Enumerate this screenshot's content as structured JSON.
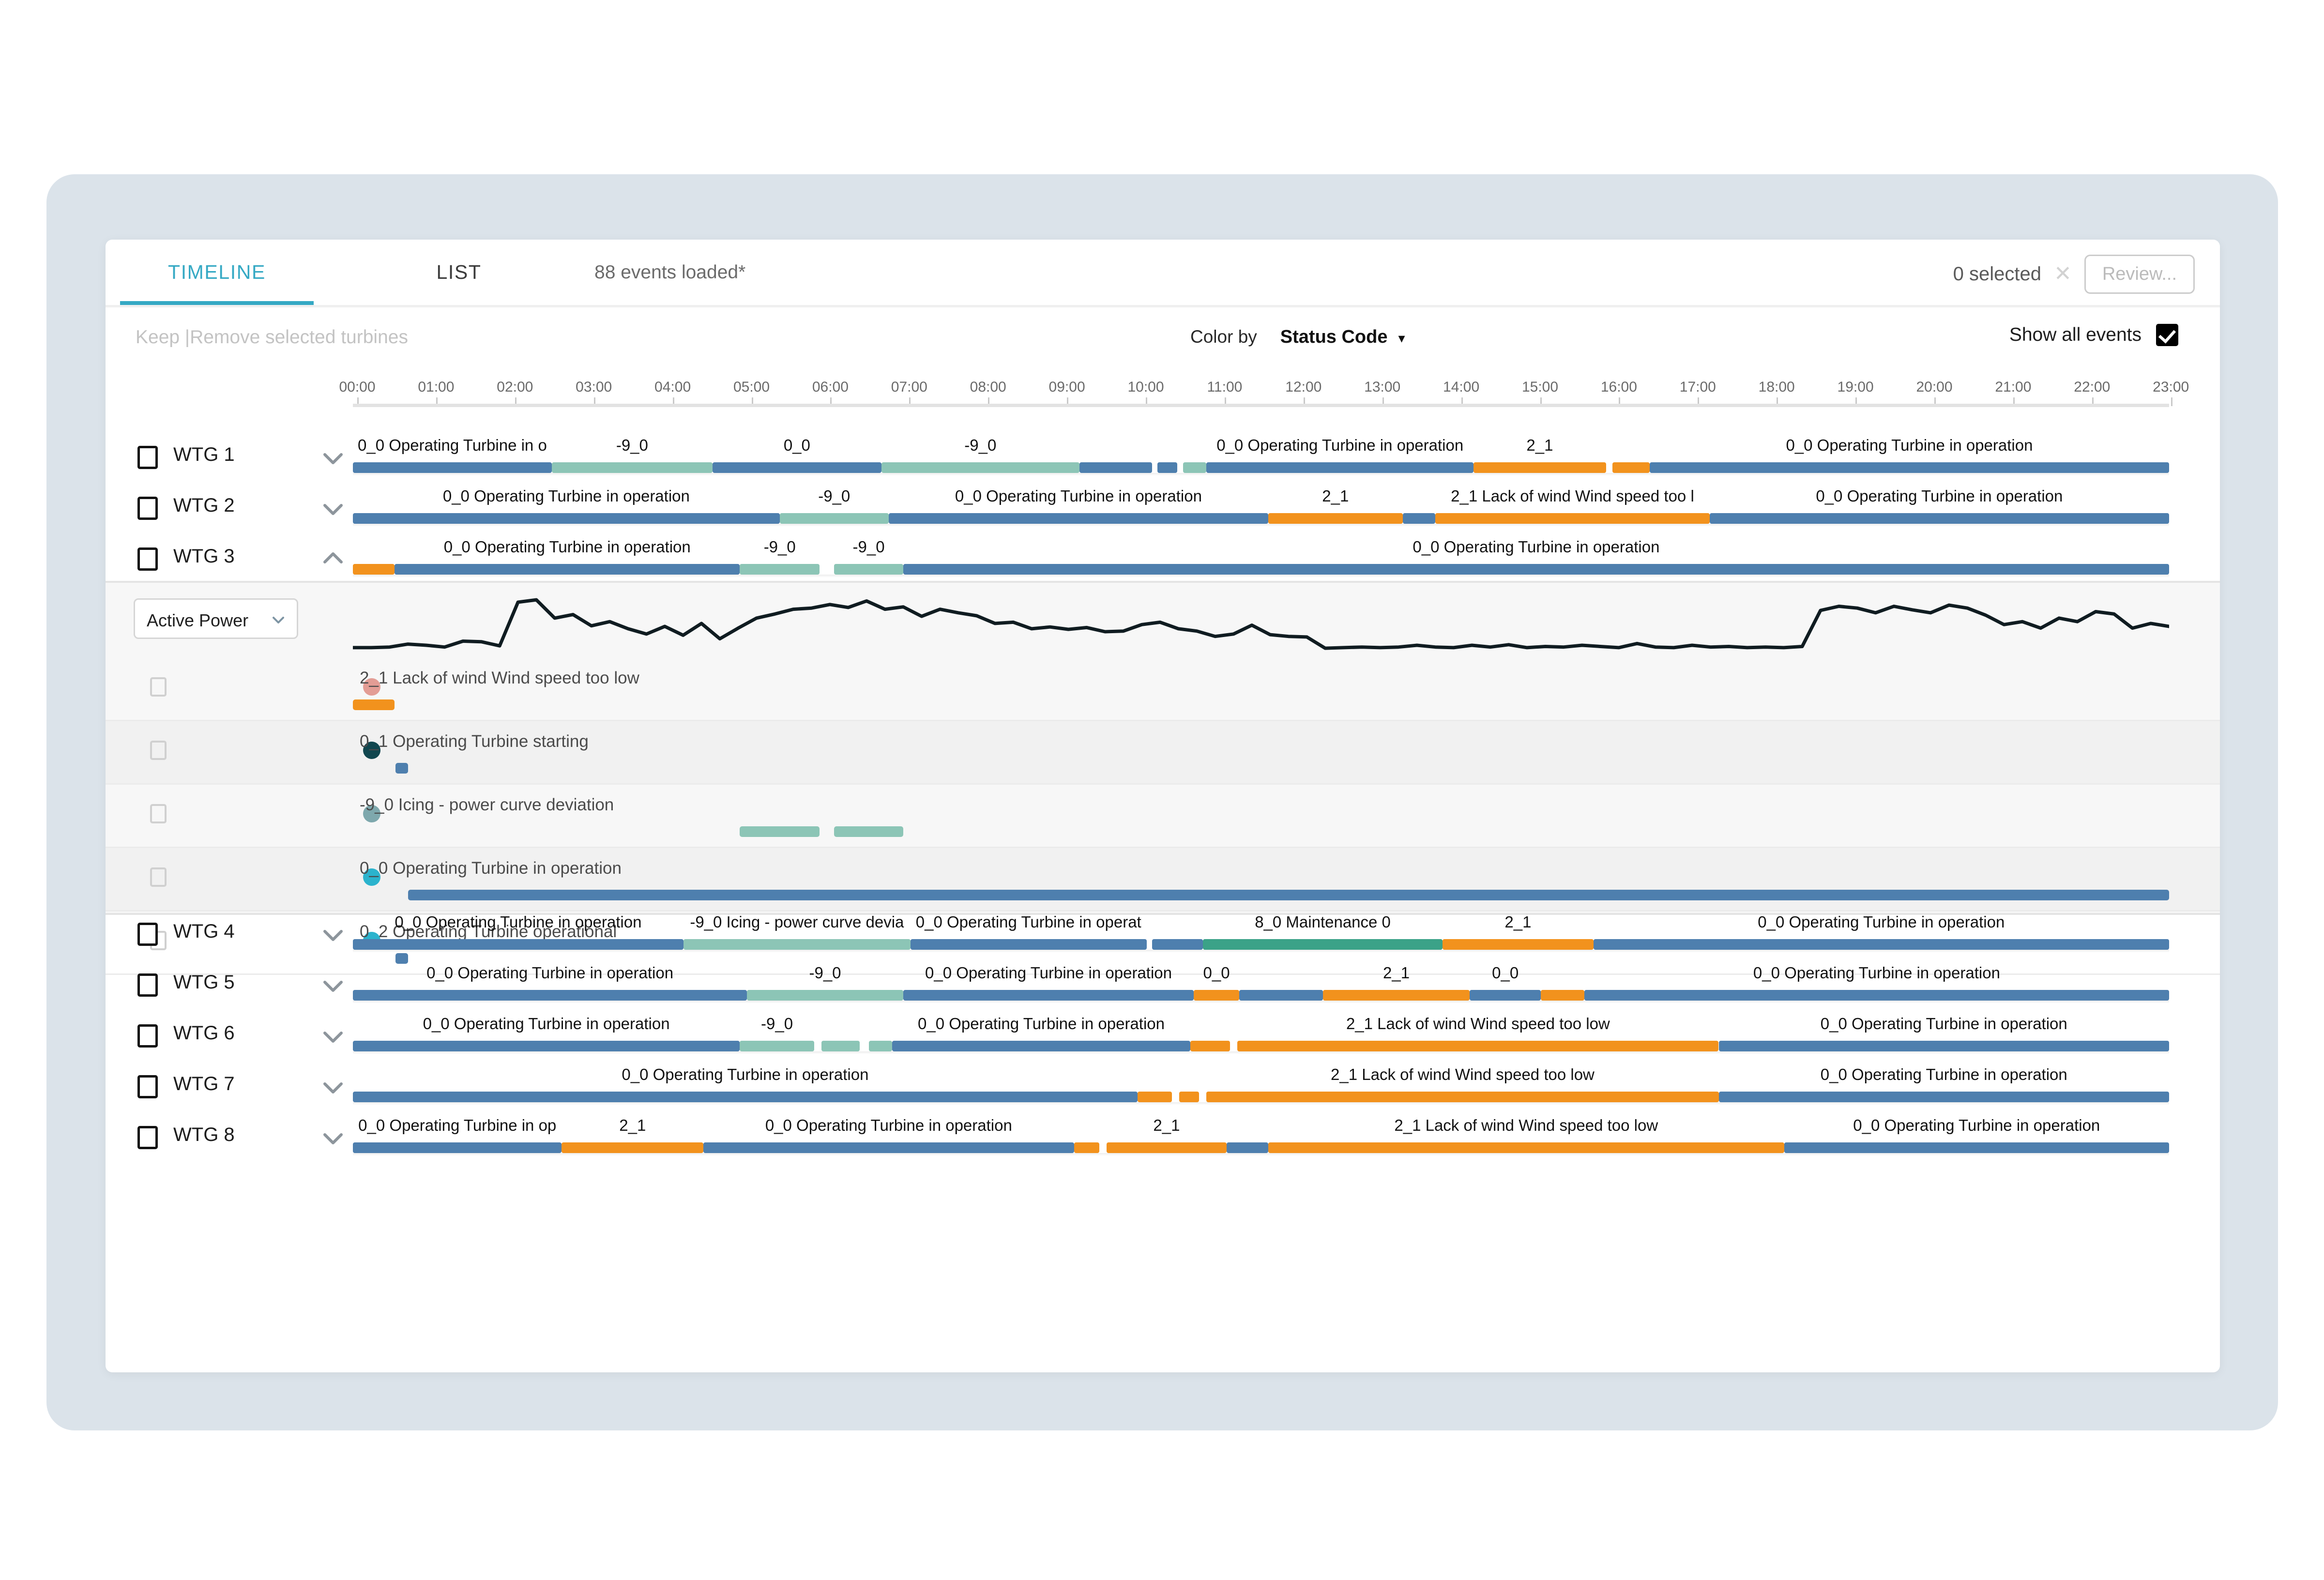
{
  "header": {
    "tabs": [
      {
        "id": "timeline",
        "label": "TIMELINE",
        "active": true
      },
      {
        "id": "list",
        "label": "LIST",
        "active": false
      }
    ],
    "events_loaded": "88 events loaded*",
    "selected_count": "0 selected",
    "clear_selection_icon": "close-icon",
    "review_button": "Review..."
  },
  "toolbar": {
    "keep_label": "Keep",
    "separator": " |",
    "remove_label": "Remove selected turbines",
    "colorby_label": "Color by",
    "colorby_value": "Status Code",
    "colorby_caret": "caret-down-icon",
    "show_all_events_label": "Show all events",
    "show_all_events_checked": true
  },
  "axis": {
    "ticks": [
      "00:00",
      "01:00",
      "02:00",
      "03:00",
      "04:00",
      "05:00",
      "06:00",
      "07:00",
      "08:00",
      "09:00",
      "10:00",
      "11:00",
      "12:00",
      "13:00",
      "14:00",
      "15:00",
      "16:00",
      "17:00",
      "18:00",
      "19:00",
      "20:00",
      "21:00",
      "22:00",
      "23:00"
    ]
  },
  "colors": {
    "accent": "#35a9c4",
    "operating_blue": "#4e7fae",
    "lack_of_wind_orange": "#f2921d",
    "icing_green": "#8cc5b6",
    "maintenance_teal": "#3ba288",
    "dot_salmon": "#e39d95",
    "dot_dark_teal": "#11474f",
    "dot_grey_teal": "#7ea8ad",
    "dot_cyan": "#2bb3cd"
  },
  "turbines": [
    {
      "name": "WTG 1",
      "expanded": false,
      "chevron": "chevron-down-icon",
      "checked": false,
      "segments": [
        {
          "label": "0_0 Operating Turbine in o",
          "start": 0.0,
          "end": 0.1095,
          "color": "operating_blue"
        },
        {
          "label": "-9_0",
          "start": 0.1095,
          "end": 0.198,
          "color": "icing_green"
        },
        {
          "label": "0_0",
          "start": 0.198,
          "end": 0.291,
          "color": "operating_blue"
        },
        {
          "label": "-9_0",
          "start": 0.291,
          "end": 0.4,
          "color": "icing_green"
        },
        {
          "label": "",
          "start": 0.4,
          "end": 0.44,
          "color": "operating_blue"
        },
        {
          "label": "",
          "start": 0.443,
          "end": 0.454,
          "color": "operating_blue"
        },
        {
          "label": "",
          "start": 0.457,
          "end": 0.47,
          "color": "icing_green"
        },
        {
          "label": "0_0 Operating Turbine in operation",
          "start": 0.47,
          "end": 0.617,
          "color": "operating_blue"
        },
        {
          "label": "2_1",
          "start": 0.617,
          "end": 0.69,
          "color": "lack_of_wind_orange"
        },
        {
          "label": "",
          "start": 0.6935,
          "end": 0.714,
          "color": "lack_of_wind_orange"
        },
        {
          "label": "0_0 Operating Turbine in operation",
          "start": 0.714,
          "end": 1.0,
          "color": "operating_blue"
        }
      ]
    },
    {
      "name": "WTG 2",
      "expanded": false,
      "chevron": "chevron-down-icon",
      "checked": false,
      "segments": [
        {
          "label": "0_0 Operating Turbine in operation",
          "start": 0.0,
          "end": 0.235,
          "color": "operating_blue"
        },
        {
          "label": "-9_0",
          "start": 0.235,
          "end": 0.295,
          "color": "icing_green"
        },
        {
          "label": "0_0 Operating Turbine in operation",
          "start": 0.295,
          "end": 0.504,
          "color": "operating_blue"
        },
        {
          "label": "2_1",
          "start": 0.504,
          "end": 0.578,
          "color": "lack_of_wind_orange"
        },
        {
          "label": "",
          "start": 0.578,
          "end": 0.596,
          "color": "operating_blue"
        },
        {
          "label": "2_1 Lack of wind Wind speed too l",
          "start": 0.596,
          "end": 0.747,
          "color": "lack_of_wind_orange"
        },
        {
          "label": "0_0 Operating Turbine in operation",
          "start": 0.747,
          "end": 1.0,
          "color": "operating_blue"
        }
      ]
    },
    {
      "name": "WTG 3",
      "expanded": true,
      "chevron": "chevron-up-icon",
      "checked": false,
      "segments": [
        {
          "label": "",
          "start": 0.0,
          "end": 0.023,
          "color": "lack_of_wind_orange"
        },
        {
          "label": "0_0 Operating Turbine in operation",
          "start": 0.023,
          "end": 0.213,
          "color": "operating_blue"
        },
        {
          "label": "-9_0",
          "start": 0.213,
          "end": 0.257,
          "color": "icing_green"
        },
        {
          "label": "-9_0",
          "start": 0.265,
          "end": 0.303,
          "color": "icing_green"
        },
        {
          "label": "0_0 Operating Turbine in operation",
          "start": 0.303,
          "end": 1.0,
          "color": "operating_blue"
        }
      ]
    }
  ],
  "detail": {
    "metric_select_value": "Active Power",
    "metric_select_caret": "chevron-down-icon",
    "chart_data": {
      "type": "line",
      "title": "Active Power",
      "xlabel": "",
      "ylabel": "Active Power",
      "grid": false,
      "legend": "none",
      "x": [
        0,
        1,
        2,
        3,
        4,
        5,
        6,
        7,
        8,
        9,
        10,
        11,
        12,
        13,
        14,
        15,
        16,
        17,
        18,
        19,
        20,
        21,
        22,
        23,
        24,
        25,
        26,
        27,
        28,
        29,
        30,
        31,
        32,
        33,
        34,
        35,
        36,
        37,
        38,
        39,
        40,
        41,
        42,
        43,
        44,
        45,
        46,
        47,
        48,
        49,
        50,
        51,
        52,
        53,
        54,
        55,
        56,
        57,
        58,
        59,
        60,
        61,
        62,
        63,
        64,
        65,
        66,
        67,
        68,
        69,
        70,
        71,
        72,
        73,
        74,
        75,
        76,
        77,
        78,
        79,
        80,
        81,
        82,
        83,
        84,
        85,
        86,
        87,
        88,
        89,
        90,
        91,
        92,
        93,
        94,
        95,
        96,
        97,
        98,
        99
      ],
      "values": [
        5,
        5,
        6,
        11,
        9,
        6,
        16,
        15,
        8,
        82,
        86,
        55,
        61,
        42,
        49,
        37,
        28,
        41,
        26,
        46,
        20,
        38,
        55,
        62,
        70,
        72,
        78,
        73,
        84,
        70,
        74,
        58,
        70,
        64,
        59,
        46,
        48,
        37,
        40,
        36,
        39,
        32,
        33,
        44,
        48,
        37,
        33,
        24,
        28,
        43,
        27,
        24,
        23,
        4,
        5,
        6,
        5,
        6,
        9,
        6,
        5,
        9,
        6,
        10,
        5,
        7,
        6,
        9,
        7,
        5,
        12,
        6,
        5,
        9,
        6,
        7,
        5,
        6,
        5,
        7,
        68,
        75,
        72,
        64,
        75,
        69,
        64,
        77,
        72,
        60,
        44,
        49,
        38,
        55,
        49,
        66,
        62,
        38,
        46,
        41
      ],
      "ylim": [
        0,
        100
      ]
    },
    "events": [
      {
        "label": "2_1 Lack of wind Wind speed too low",
        "dot": "dot_salmon",
        "checked": false,
        "bars": [
          {
            "start": 0.0,
            "end": 0.023,
            "color": "lack_of_wind_orange"
          }
        ]
      },
      {
        "label": "0_1 Operating Turbine starting",
        "dot": "dot_dark_teal",
        "checked": false,
        "bars": [
          {
            "start": 0.0235,
            "end": 0.0305,
            "color": "operating_blue"
          }
        ]
      },
      {
        "label": "-9_0 Icing - power curve deviation",
        "dot": "dot_grey_teal",
        "checked": false,
        "bars": [
          {
            "start": 0.213,
            "end": 0.257,
            "color": "icing_green"
          },
          {
            "start": 0.265,
            "end": 0.303,
            "color": "icing_green"
          }
        ]
      },
      {
        "label": "0_0 Operating Turbine in operation",
        "dot": "dot_cyan",
        "checked": false,
        "bars": [
          {
            "start": 0.0305,
            "end": 1.0,
            "color": "operating_blue"
          }
        ]
      },
      {
        "label": "0_2 Operating Turbine operational",
        "dot": "dot_cyan",
        "checked": false,
        "bars": [
          {
            "start": 0.0235,
            "end": 0.0305,
            "color": "operating_blue"
          }
        ]
      }
    ]
  },
  "turbines_lower": [
    {
      "name": "WTG 4",
      "expanded": false,
      "chevron": "chevron-down-icon",
      "checked": false,
      "segments": [
        {
          "label": "0_0 Operating Turbine in operation",
          "start": 0.0,
          "end": 0.182,
          "color": "operating_blue"
        },
        {
          "label": "-9_0 Icing - power curve devia",
          "start": 0.182,
          "end": 0.307,
          "color": "icing_green"
        },
        {
          "label": "0_0 Operating Turbine in operat",
          "start": 0.307,
          "end": 0.437,
          "color": "operating_blue"
        },
        {
          "label": "",
          "start": 0.44,
          "end": 0.468,
          "color": "operating_blue"
        },
        {
          "label": "8_0 Maintenance 0",
          "start": 0.468,
          "end": 0.6,
          "color": "maintenance_teal"
        },
        {
          "label": "2_1",
          "start": 0.6,
          "end": 0.683,
          "color": "lack_of_wind_orange"
        },
        {
          "label": "0_0 Operating Turbine in operation",
          "start": 0.683,
          "end": 1.0,
          "color": "operating_blue"
        }
      ]
    },
    {
      "name": "WTG 5",
      "expanded": false,
      "chevron": "chevron-down-icon",
      "checked": false,
      "segments": [
        {
          "label": "0_0 Operating Turbine in operation",
          "start": 0.0,
          "end": 0.217,
          "color": "operating_blue"
        },
        {
          "label": "-9_0",
          "start": 0.217,
          "end": 0.303,
          "color": "icing_green"
        },
        {
          "label": "0_0 Operating Turbine in operation",
          "start": 0.303,
          "end": 0.463,
          "color": "operating_blue"
        },
        {
          "label": "0_0",
          "start": 0.463,
          "end": 0.488,
          "color": "lack_of_wind_orange"
        },
        {
          "label": "",
          "start": 0.488,
          "end": 0.534,
          "color": "operating_blue"
        },
        {
          "label": "2_1",
          "start": 0.534,
          "end": 0.615,
          "color": "lack_of_wind_orange"
        },
        {
          "label": "0_0",
          "start": 0.615,
          "end": 0.654,
          "color": "operating_blue"
        },
        {
          "label": "",
          "start": 0.654,
          "end": 0.678,
          "color": "lack_of_wind_orange"
        },
        {
          "label": "0_0 Operating Turbine in operation",
          "start": 0.678,
          "end": 1.0,
          "color": "operating_blue"
        }
      ]
    },
    {
      "name": "WTG 6",
      "expanded": false,
      "chevron": "chevron-down-icon",
      "checked": false,
      "segments": [
        {
          "label": "0_0 Operating Turbine in operation",
          "start": 0.0,
          "end": 0.213,
          "color": "operating_blue"
        },
        {
          "label": "-9_0",
          "start": 0.213,
          "end": 0.254,
          "color": "icing_green"
        },
        {
          "label": "",
          "start": 0.258,
          "end": 0.279,
          "color": "icing_green"
        },
        {
          "label": "",
          "start": 0.284,
          "end": 0.297,
          "color": "icing_green"
        },
        {
          "label": "0_0 Operating Turbine in operation",
          "start": 0.297,
          "end": 0.461,
          "color": "operating_blue"
        },
        {
          "label": "",
          "start": 0.461,
          "end": 0.483,
          "color": "lack_of_wind_orange"
        },
        {
          "label": "2_1 Lack of wind Wind speed too low",
          "start": 0.487,
          "end": 0.752,
          "color": "lack_of_wind_orange"
        },
        {
          "label": "0_0 Operating Turbine in operation",
          "start": 0.752,
          "end": 1.0,
          "color": "operating_blue"
        }
      ]
    },
    {
      "name": "WTG 7",
      "expanded": false,
      "chevron": "chevron-down-icon",
      "checked": false,
      "segments": [
        {
          "label": "0_0 Operating Turbine in operation",
          "start": 0.0,
          "end": 0.432,
          "color": "operating_blue"
        },
        {
          "label": "",
          "start": 0.432,
          "end": 0.451,
          "color": "lack_of_wind_orange"
        },
        {
          "label": "",
          "start": 0.455,
          "end": 0.466,
          "color": "lack_of_wind_orange"
        },
        {
          "label": "2_1 Lack of wind Wind speed too low",
          "start": 0.47,
          "end": 0.752,
          "color": "lack_of_wind_orange"
        },
        {
          "label": "0_0 Operating Turbine in operation",
          "start": 0.752,
          "end": 1.0,
          "color": "operating_blue"
        }
      ]
    },
    {
      "name": "WTG 8",
      "expanded": false,
      "chevron": "chevron-down-icon",
      "checked": false,
      "segments": [
        {
          "label": "0_0 Operating Turbine in op",
          "start": 0.0,
          "end": 0.115,
          "color": "operating_blue"
        },
        {
          "label": "2_1",
          "start": 0.115,
          "end": 0.193,
          "color": "lack_of_wind_orange"
        },
        {
          "label": "0_0 Operating Turbine in operation",
          "start": 0.193,
          "end": 0.397,
          "color": "operating_blue"
        },
        {
          "label": "",
          "start": 0.397,
          "end": 0.411,
          "color": "lack_of_wind_orange"
        },
        {
          "label": "2_1",
          "start": 0.415,
          "end": 0.481,
          "color": "lack_of_wind_orange"
        },
        {
          "label": "",
          "start": 0.481,
          "end": 0.504,
          "color": "operating_blue"
        },
        {
          "label": "2_1 Lack of wind Wind speed too low",
          "start": 0.504,
          "end": 0.788,
          "color": "lack_of_wind_orange"
        },
        {
          "label": "0_0 Operating Turbine in operation",
          "start": 0.788,
          "end": 1.0,
          "color": "operating_blue"
        }
      ]
    }
  ]
}
